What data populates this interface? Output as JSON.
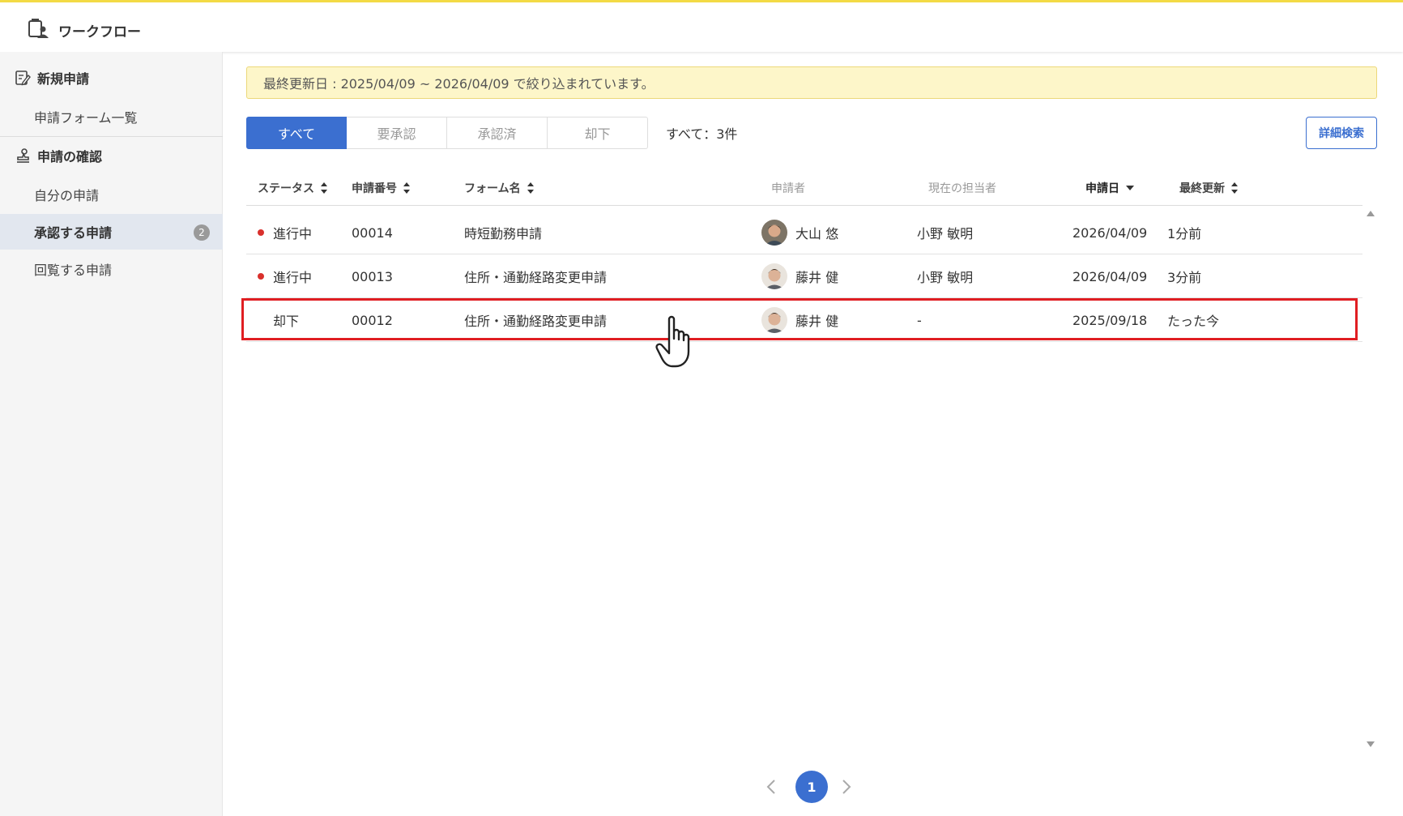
{
  "app": {
    "title": "ワークフロー"
  },
  "sidebar": {
    "section_new": "新規申請",
    "item_form_list": "申請フォーム一覧",
    "section_confirm": "申請の確認",
    "item_mine": "自分の申請",
    "item_approve": "承認する申請",
    "item_approve_badge": "2",
    "item_circulate": "回覧する申請"
  },
  "notice": {
    "text": "最終更新日 : 2025/04/09 ~ 2026/04/09 で絞り込まれています。"
  },
  "tabs": [
    {
      "label": "すべて",
      "active": true
    },
    {
      "label": "要承認",
      "active": false
    },
    {
      "label": "承認済",
      "active": false
    },
    {
      "label": "却下",
      "active": false
    }
  ],
  "count_text": "すべて：3件",
  "detail_search_label": "詳細検索",
  "table": {
    "headers": {
      "status": "ステータス",
      "number": "申請番号",
      "form": "フォーム名",
      "applicant": "申請者",
      "assignee": "現在の担当者",
      "date": "申請日",
      "updated": "最終更新"
    },
    "rows": [
      {
        "status": "進行中",
        "in_progress": true,
        "number": "00014",
        "form": "時短勤務申請",
        "applicant": "大山 悠",
        "assignee": "小野 敏明",
        "date": "2026/04/09",
        "updated": "1分前"
      },
      {
        "status": "進行中",
        "in_progress": true,
        "number": "00013",
        "form": "住所・通勤経路変更申請",
        "applicant": "藤井 健",
        "assignee": "小野 敏明",
        "date": "2026/04/09",
        "updated": "3分前"
      },
      {
        "status": "却下",
        "in_progress": false,
        "number": "00012",
        "form": "住所・通勤経路変更申請",
        "applicant": "藤井 健",
        "assignee": "-",
        "date": "2025/09/18",
        "updated": "たった今"
      }
    ]
  },
  "pagination": {
    "current": "1"
  },
  "colors": {
    "accent": "#3b6fd0",
    "status_dot": "#d9302c",
    "highlight": "#e01e22",
    "notice_bg": "#fdf6c9"
  }
}
